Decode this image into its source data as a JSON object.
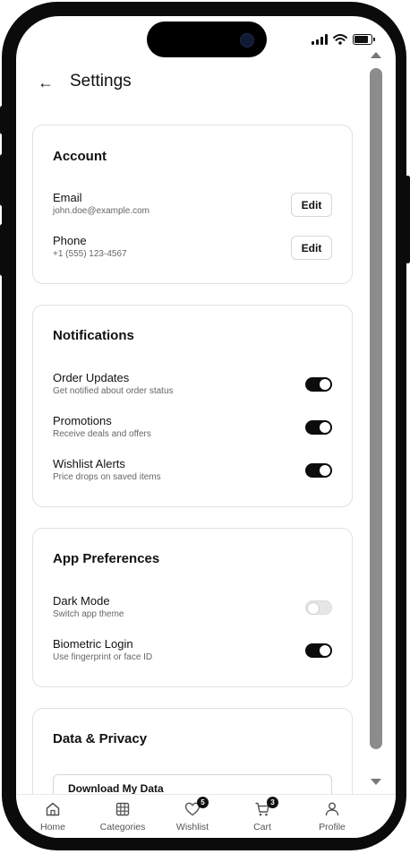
{
  "header": {
    "title": "Settings"
  },
  "account": {
    "title": "Account",
    "rows": [
      {
        "label": "Email",
        "value": "john.doe@example.com",
        "button": "Edit"
      },
      {
        "label": "Phone",
        "value": "+1 (555) 123-4567",
        "button": "Edit"
      }
    ]
  },
  "notifications": {
    "title": "Notifications",
    "rows": [
      {
        "label": "Order Updates",
        "description": "Get notified about order status",
        "enabled": true
      },
      {
        "label": "Promotions",
        "description": "Receive deals and offers",
        "enabled": true
      },
      {
        "label": "Wishlist Alerts",
        "description": "Price drops on saved items",
        "enabled": true
      }
    ]
  },
  "preferences": {
    "title": "App Preferences",
    "rows": [
      {
        "label": "Dark Mode",
        "description": "Switch app theme",
        "enabled": false
      },
      {
        "label": "Biometric Login",
        "description": "Use fingerprint or face ID",
        "enabled": true
      }
    ]
  },
  "privacy": {
    "title": "Data & Privacy",
    "download_button": "Download My Data"
  },
  "bottom_nav": {
    "items": [
      {
        "label": "Home",
        "icon": "home-icon"
      },
      {
        "label": "Categories",
        "icon": "grid-icon"
      },
      {
        "label": "Wishlist",
        "icon": "heart-icon",
        "badge": "5"
      },
      {
        "label": "Cart",
        "icon": "cart-icon",
        "badge": "3"
      },
      {
        "label": "Profile",
        "icon": "person-icon"
      }
    ]
  },
  "colors": {
    "toggle_on": "#0c0c0c",
    "toggle_off": "#e6e6e6",
    "frame": "#0b0b0b"
  }
}
